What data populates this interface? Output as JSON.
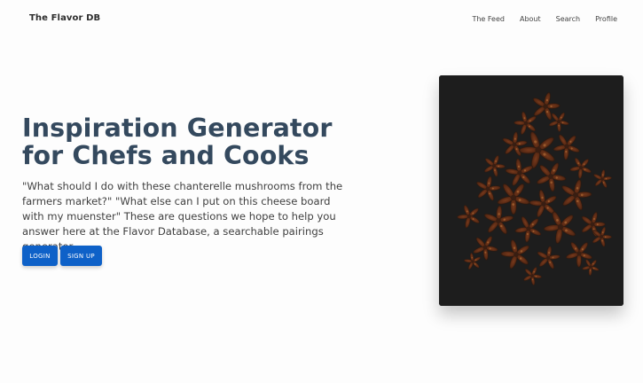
{
  "header": {
    "brand": "The Flavor DB",
    "nav": [
      "The Feed",
      "About",
      "Search",
      "Profile"
    ]
  },
  "hero": {
    "title_line1": "Inspiration Generator",
    "title_line2": "for Chefs and Cooks",
    "description": "\"What should I do with these chanterelle mushrooms from the farmers market?\" \"What else can I put on this cheese board with my muenster\" These are questions we hope to help you answer here at the Flavor Database, a searchable pairings generator.",
    "login_label": "LOGIN",
    "signup_label": "SIGN UP"
  },
  "image": {
    "subject": "star-anise-pods-on-dark-background"
  },
  "colors": {
    "title": "#34495e",
    "button": "#0e61c8",
    "photo_bg": "#1b1b1b"
  }
}
